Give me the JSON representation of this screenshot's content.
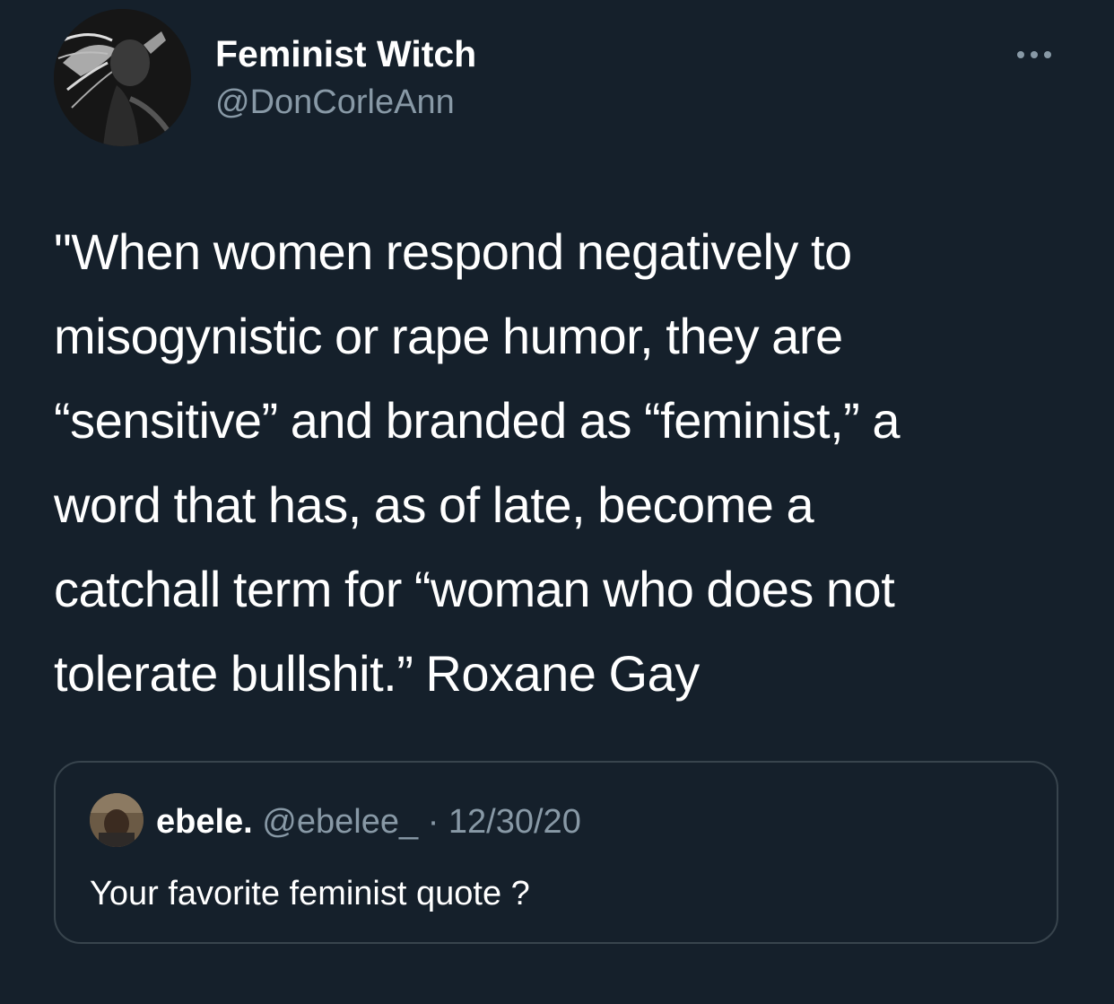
{
  "author": {
    "display_name": "Feminist Witch",
    "handle": "@DonCorleAnn"
  },
  "menu": {
    "more_icon": "more-dots-icon"
  },
  "tweet": {
    "text": "\"When women respond negatively to\nmisogynistic or rape humor, they are\n“sensitive” and branded as “feminist,” a\nword that has, as of late, become a\ncatchall term for “woman who does not\ntolerate bullshit.” Roxane Gay"
  },
  "quoted_tweet": {
    "display_name": "ebele.",
    "handle": "@ebelee_",
    "separator": "·",
    "date": "12/30/20",
    "text": "Your favorite feminist quote ?"
  },
  "colors": {
    "background": "#15202b",
    "text_primary": "#ffffff",
    "text_secondary": "#8899a6",
    "border": "#38444d"
  }
}
